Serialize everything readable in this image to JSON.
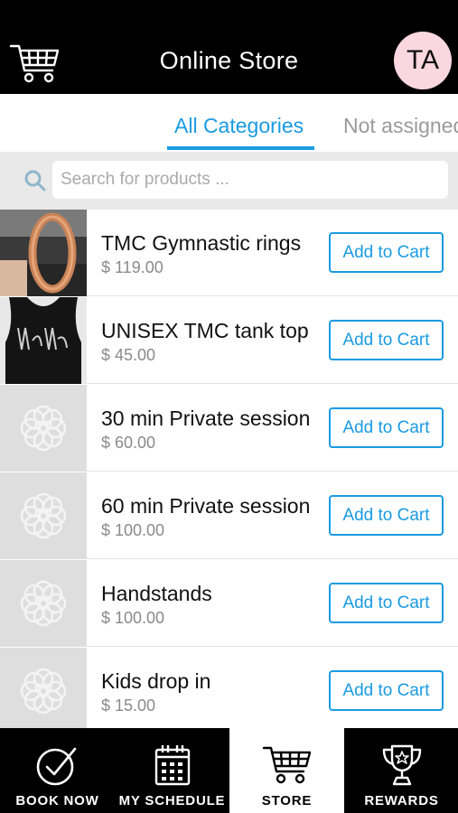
{
  "header": {
    "title": "Online Store",
    "avatar_initials": "TA",
    "cart_icon": "cart-icon"
  },
  "tabs": [
    {
      "label": "All Categories",
      "active": true
    },
    {
      "label": "Not assigned",
      "active": false
    }
  ],
  "search": {
    "placeholder": "Search for products ...",
    "value": ""
  },
  "products": [
    {
      "name": "TMC Gymnastic rings",
      "price": "$ 119.00",
      "button": "Add to Cart",
      "thumb": "rings-photo"
    },
    {
      "name": "UNISEX TMC tank top",
      "price": "$ 45.00",
      "button": "Add to Cart",
      "thumb": "tank-photo"
    },
    {
      "name": "30 min Private session",
      "price": "$ 60.00",
      "button": "Add to Cart",
      "thumb": "placeholder-logo"
    },
    {
      "name": "60 min Private session",
      "price": "$ 100.00",
      "button": "Add to Cart",
      "thumb": "placeholder-logo"
    },
    {
      "name": "Handstands",
      "price": "$ 100.00",
      "button": "Add to Cart",
      "thumb": "placeholder-logo"
    },
    {
      "name": "Kids drop in",
      "price": "$ 15.00",
      "button": "Add to Cart",
      "thumb": "placeholder-logo"
    }
  ],
  "nav": [
    {
      "label": "BOOK NOW",
      "icon": "check-circle-icon",
      "active": false
    },
    {
      "label": "MY SCHEDULE",
      "icon": "calendar-icon",
      "active": false
    },
    {
      "label": "STORE",
      "icon": "cart-icon",
      "active": true
    },
    {
      "label": "REWARDS",
      "icon": "trophy-icon",
      "active": false
    }
  ],
  "colors": {
    "accent": "#1a9be2",
    "header_bg": "#000000",
    "avatar_bg": "#fbd7e2",
    "search_bar_bg": "#e9e9e9"
  }
}
